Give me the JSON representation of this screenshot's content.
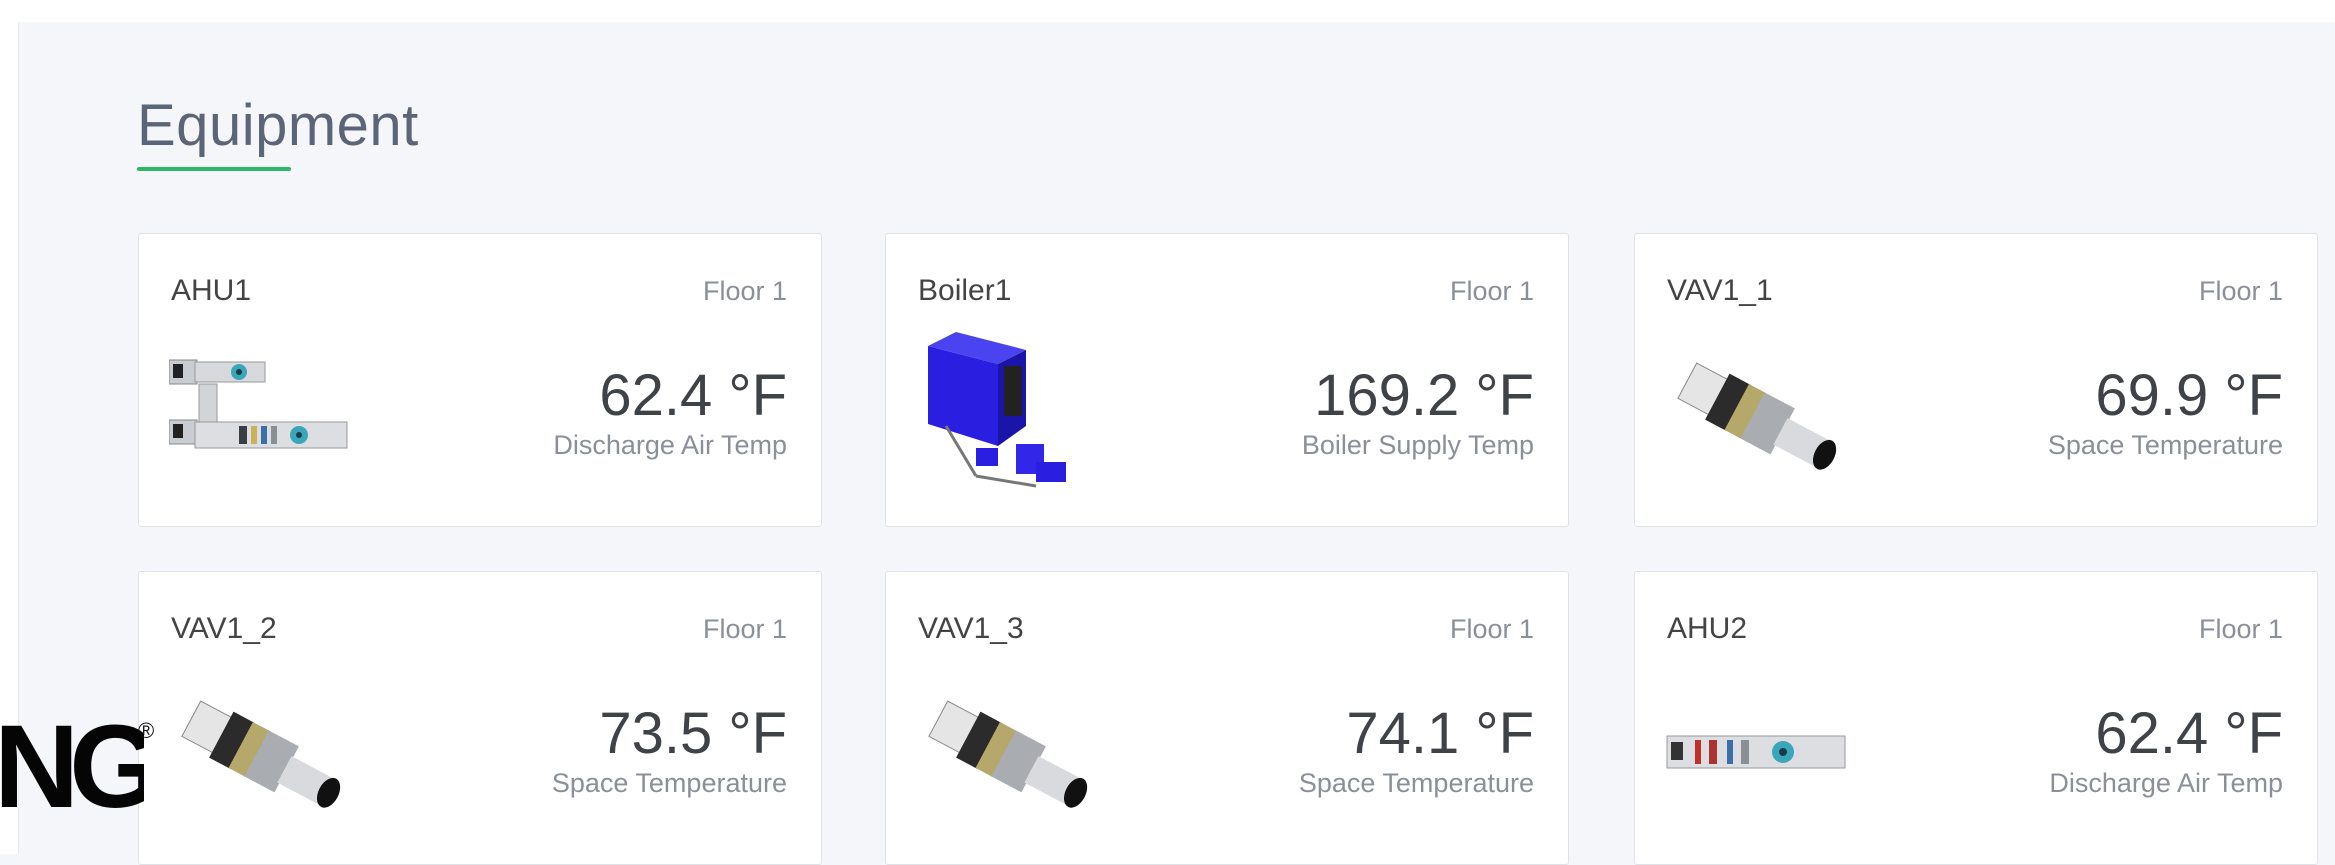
{
  "section": {
    "title": "Equipment"
  },
  "brand": {
    "text": "NG",
    "registered": "®"
  },
  "cards": [
    {
      "name": "AHU1",
      "floor": "Floor 1",
      "value": "62.4 °F",
      "label": "Discharge Air Temp",
      "icon": "ahu-unit-icon"
    },
    {
      "name": "Boiler1",
      "floor": "Floor 1",
      "value": "169.2 °F",
      "label": "Boiler Supply Temp",
      "icon": "boiler-icon"
    },
    {
      "name": "VAV1_1",
      "floor": "Floor 1",
      "value": "69.9 °F",
      "label": "Space Temperature",
      "icon": "vav-box-icon"
    },
    {
      "name": "VAV1_2",
      "floor": "Floor 1",
      "value": "73.5 °F",
      "label": "Space Temperature",
      "icon": "vav-box-icon"
    },
    {
      "name": "VAV1_3",
      "floor": "Floor 1",
      "value": "74.1 °F",
      "label": "Space Temperature",
      "icon": "vav-box-icon"
    },
    {
      "name": "AHU2",
      "floor": "Floor 1",
      "value": "62.4 °F",
      "label": "Discharge Air Temp",
      "icon": "ahu-unit-icon"
    }
  ],
  "colors": {
    "accent": "#2fb768",
    "boiler": "#2a1fe0"
  }
}
